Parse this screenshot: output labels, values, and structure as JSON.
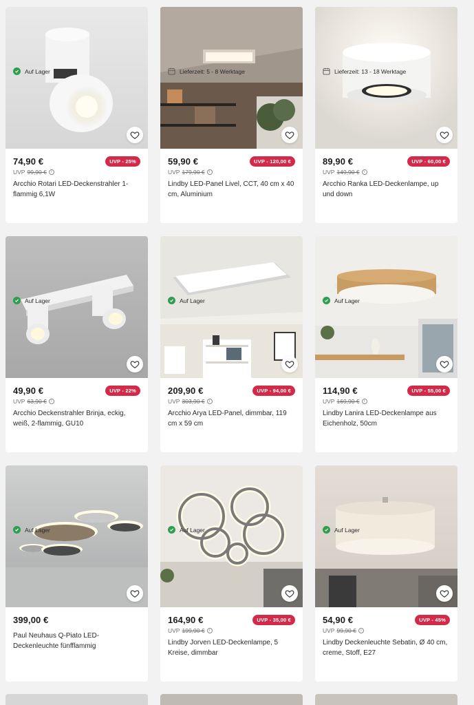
{
  "products": [
    {
      "price": "74,90 €",
      "uvp_label": "UVP",
      "old_price": "99,90 €",
      "badge": "UVP - 25%",
      "title": "Arcchio Rotari LED-Deckenstrahler 1-flammig 6,1W",
      "availability": "Auf Lager",
      "availability_type": "stock",
      "image_icon": "spotlight-image"
    },
    {
      "price": "59,90 €",
      "uvp_label": "UVP",
      "old_price": "179,90 €",
      "badge": "UVP - 120,00 €",
      "title": "Lindby LED-Panel Livel, CCT, 40 cm x 40 cm, Aluminium",
      "availability": "Lieferzeit: 5 - 8 Werktage",
      "availability_type": "delivery",
      "image_icon": "panel-room-image"
    },
    {
      "price": "89,90 €",
      "uvp_label": "UVP",
      "old_price": "149,90 €",
      "badge": "UVP - 60,00 €",
      "title": "Arcchio Ranka LED-Deckenlampe, up und down",
      "availability": "Lieferzeit: 13 - 18 Werktage",
      "availability_type": "delivery",
      "image_icon": "ceiling-lamp-image"
    },
    {
      "price": "49,90 €",
      "uvp_label": "UVP",
      "old_price": "63,90 €",
      "badge": "UVP - 22%",
      "title": "Arcchio Deckenstrahler Brinja, eckig, weiß, 2-flammig, GU10",
      "availability": "Auf Lager",
      "availability_type": "stock",
      "image_icon": "double-spot-image"
    },
    {
      "price": "209,90 €",
      "uvp_label": "UVP",
      "old_price": "303,90 €",
      "badge": "UVP - 94,00 €",
      "title": "Arcchio Arya LED-Panel, dimmbar, 119 cm x 59 cm",
      "availability": "Auf Lager",
      "availability_type": "stock",
      "image_icon": "panel-shelf-image"
    },
    {
      "price": "114,90 €",
      "uvp_label": "UVP",
      "old_price": "169,90 €",
      "badge": "UVP - 55,00 €",
      "title": "Lindby Lanira LED-Deckenlampe aus Eichenholz, 50cm",
      "availability": "Auf Lager",
      "availability_type": "stock",
      "image_icon": "oak-lamp-image"
    },
    {
      "price": "399,00 €",
      "uvp_label": "",
      "old_price": "",
      "badge": "",
      "title": "Paul Neuhaus Q-Piato LED-Deckenleuchte fünfflammig",
      "availability": "Auf Lager",
      "availability_type": "stock",
      "image_icon": "discs-lamp-image"
    },
    {
      "price": "164,90 €",
      "uvp_label": "UVP",
      "old_price": "199,90 €",
      "badge": "UVP - 35,00 €",
      "title": "Lindby Jorven LED-Deckenlampe, 5 Kreise, dimmbar",
      "availability": "Auf Lager",
      "availability_type": "stock",
      "image_icon": "rings-lamp-image"
    },
    {
      "price": "54,90 €",
      "uvp_label": "UVP",
      "old_price": "99,90 €",
      "badge": "UVP - 45%",
      "title": "Lindby Deckenleuchte Sebatin, Ø 40 cm, creme, Stoff, E27",
      "availability": "Auf Lager",
      "availability_type": "stock",
      "image_icon": "drum-lamp-image"
    }
  ],
  "colors": {
    "badge": "#d42a4a",
    "in_stock": "#2f9e4f",
    "background": "#f2f2f2"
  }
}
